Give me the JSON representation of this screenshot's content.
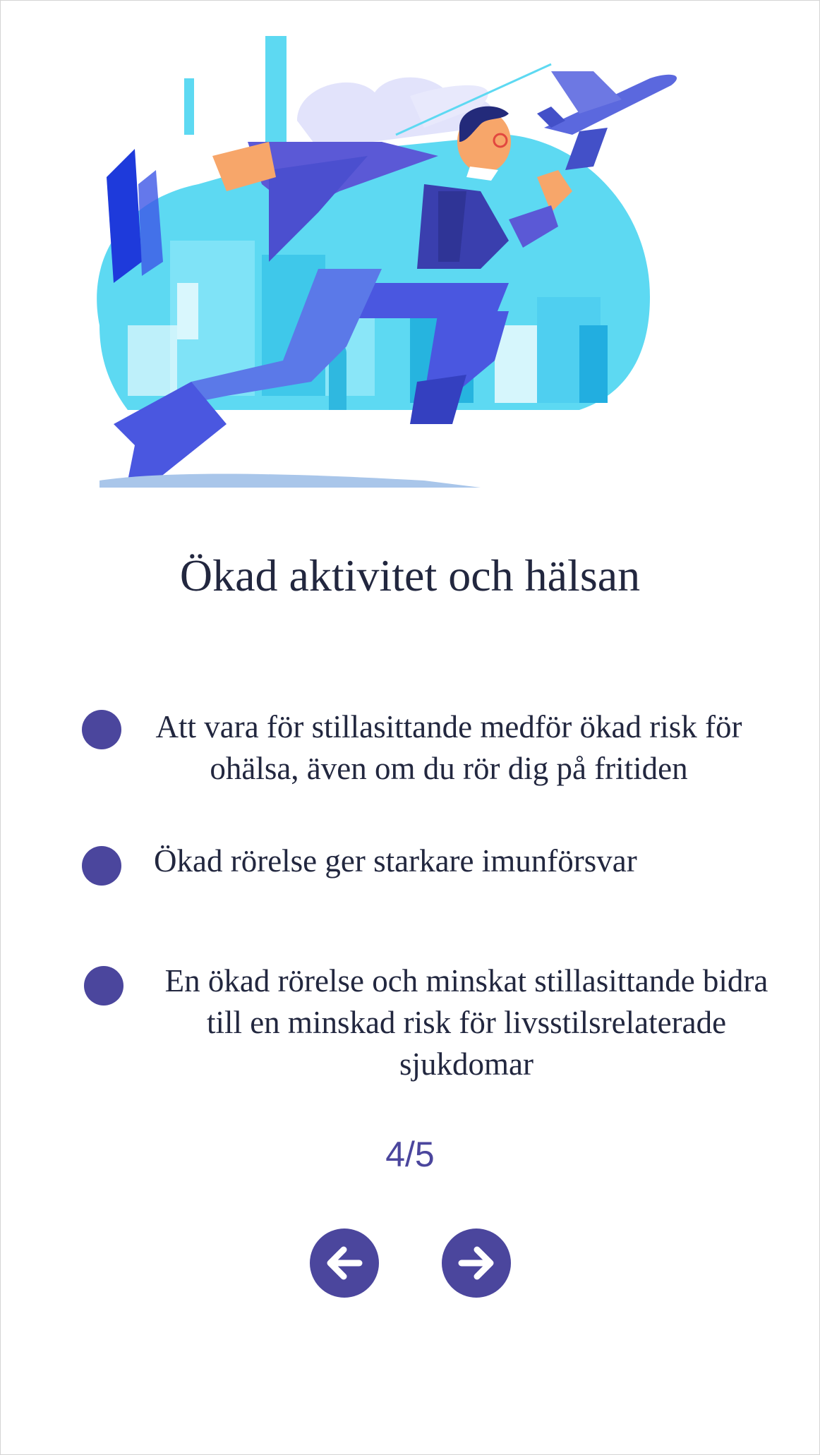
{
  "slide": {
    "title": "Ökad aktivitet och hälsan",
    "bullets": [
      "Att vara för stillasittande medför ökad risk för ohälsa, även om du rör dig på fritiden",
      "Ökad rörelse ger starkare imunförsvar",
      "En ökad rörelse och minskat stillasittande bidra till en minskad risk för livsstilsrelaterade sjukdomar"
    ],
    "counter": "4/5",
    "illustration": "flying-businessman-over-city-illustration"
  },
  "navigation": {
    "prev_icon": "arrow-left-icon",
    "next_icon": "arrow-right-icon"
  },
  "colors": {
    "accent": "#4b469d",
    "text": "#22273f",
    "cyan": "#5dd9f2",
    "blue": "#4a57e0",
    "skin": "#f7a66a"
  }
}
